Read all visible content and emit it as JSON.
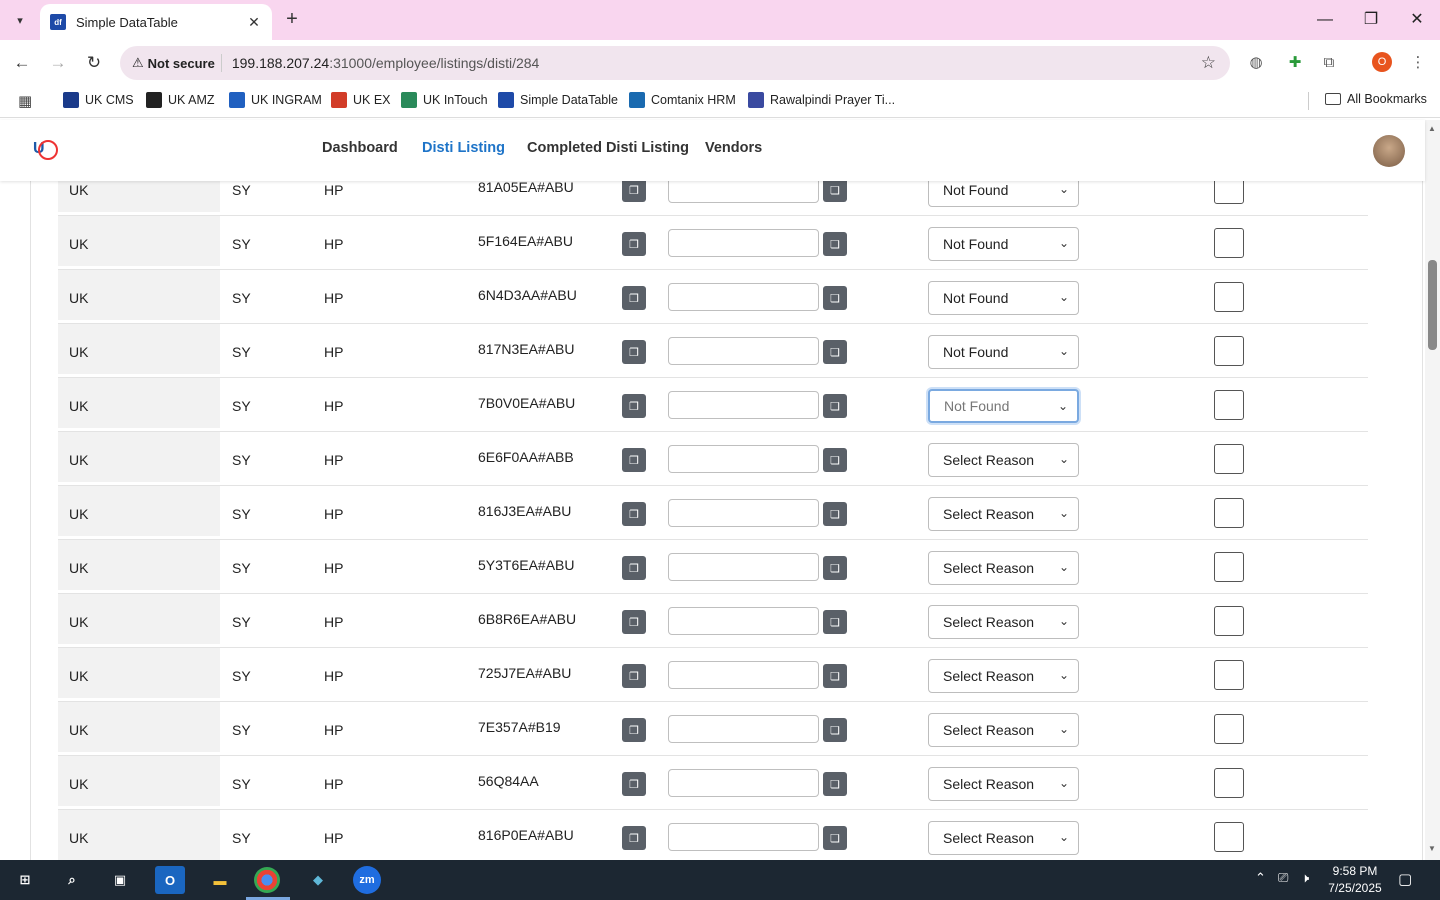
{
  "browser": {
    "tab_title": "Simple DataTable",
    "tab_favicon_text": "df",
    "url_security": "Not secure",
    "url_host": "199.188.207.24",
    "url_path": ":31000/employee/listings/disti/284",
    "profile_initial": "O"
  },
  "bookmarks": [
    {
      "label": "UK CMS",
      "icon": "cms",
      "color": "#1a3a8a"
    },
    {
      "label": "UK AMZ",
      "icon": "amazon",
      "color": "#222222"
    },
    {
      "label": "UK INGRAM",
      "icon": "ingram",
      "color": "#2060c0"
    },
    {
      "label": "UK EX",
      "icon": "ex",
      "color": "#d23c28"
    },
    {
      "label": "UK InTouch",
      "icon": "intouch",
      "color": "#2a8a5a"
    },
    {
      "label": "Simple DataTable",
      "icon": "df",
      "color": "#1e4aa8"
    },
    {
      "label": "Comtanix HRM",
      "icon": "comtanix",
      "color": "#1a6ab0"
    },
    {
      "label": "Rawalpindi Prayer Ti...",
      "icon": "prayer",
      "color": "#3a4aa0"
    }
  ],
  "all_bookmarks": "All Bookmarks",
  "nav": {
    "dashboard": "Dashboard",
    "disti_listing": "Disti Listing",
    "completed": "Completed Disti Listing",
    "vendors": "Vendors"
  },
  "rows": [
    {
      "country": "UK",
      "code": "SY",
      "brand": "HP",
      "sku": "81A05EA#ABU",
      "reason": "Not Found",
      "focused": false
    },
    {
      "country": "UK",
      "code": "SY",
      "brand": "HP",
      "sku": "5F164EA#ABU",
      "reason": "Not Found",
      "focused": false
    },
    {
      "country": "UK",
      "code": "SY",
      "brand": "HP",
      "sku": "6N4D3AA#ABU",
      "reason": "Not Found",
      "focused": false
    },
    {
      "country": "UK",
      "code": "SY",
      "brand": "HP",
      "sku": "817N3EA#ABU",
      "reason": "Not Found",
      "focused": false
    },
    {
      "country": "UK",
      "code": "SY",
      "brand": "HP",
      "sku": "7B0V0EA#ABU",
      "reason": "Not Found",
      "focused": true
    },
    {
      "country": "UK",
      "code": "SY",
      "brand": "HP",
      "sku": "6E6F0AA#ABB",
      "reason": "Select Reason",
      "focused": false
    },
    {
      "country": "UK",
      "code": "SY",
      "brand": "HP",
      "sku": "816J3EA#ABU",
      "reason": "Select Reason",
      "focused": false
    },
    {
      "country": "UK",
      "code": "SY",
      "brand": "HP",
      "sku": "5Y3T6EA#ABU",
      "reason": "Select Reason",
      "focused": false
    },
    {
      "country": "UK",
      "code": "SY",
      "brand": "HP",
      "sku": "6B8R6EA#ABU",
      "reason": "Select Reason",
      "focused": false
    },
    {
      "country": "UK",
      "code": "SY",
      "brand": "HP",
      "sku": "725J7EA#ABU",
      "reason": "Select Reason",
      "focused": false
    },
    {
      "country": "UK",
      "code": "SY",
      "brand": "HP",
      "sku": "7E357A#B19",
      "reason": "Select Reason",
      "focused": false
    },
    {
      "country": "UK",
      "code": "SY",
      "brand": "HP",
      "sku": "56Q84AA",
      "reason": "Select Reason",
      "focused": false
    },
    {
      "country": "UK",
      "code": "SY",
      "brand": "HP",
      "sku": "816P0EA#ABU",
      "reason": "Select Reason",
      "focused": false
    }
  ],
  "taskbar": {
    "time": "9:58 PM",
    "date": "7/25/2025"
  }
}
